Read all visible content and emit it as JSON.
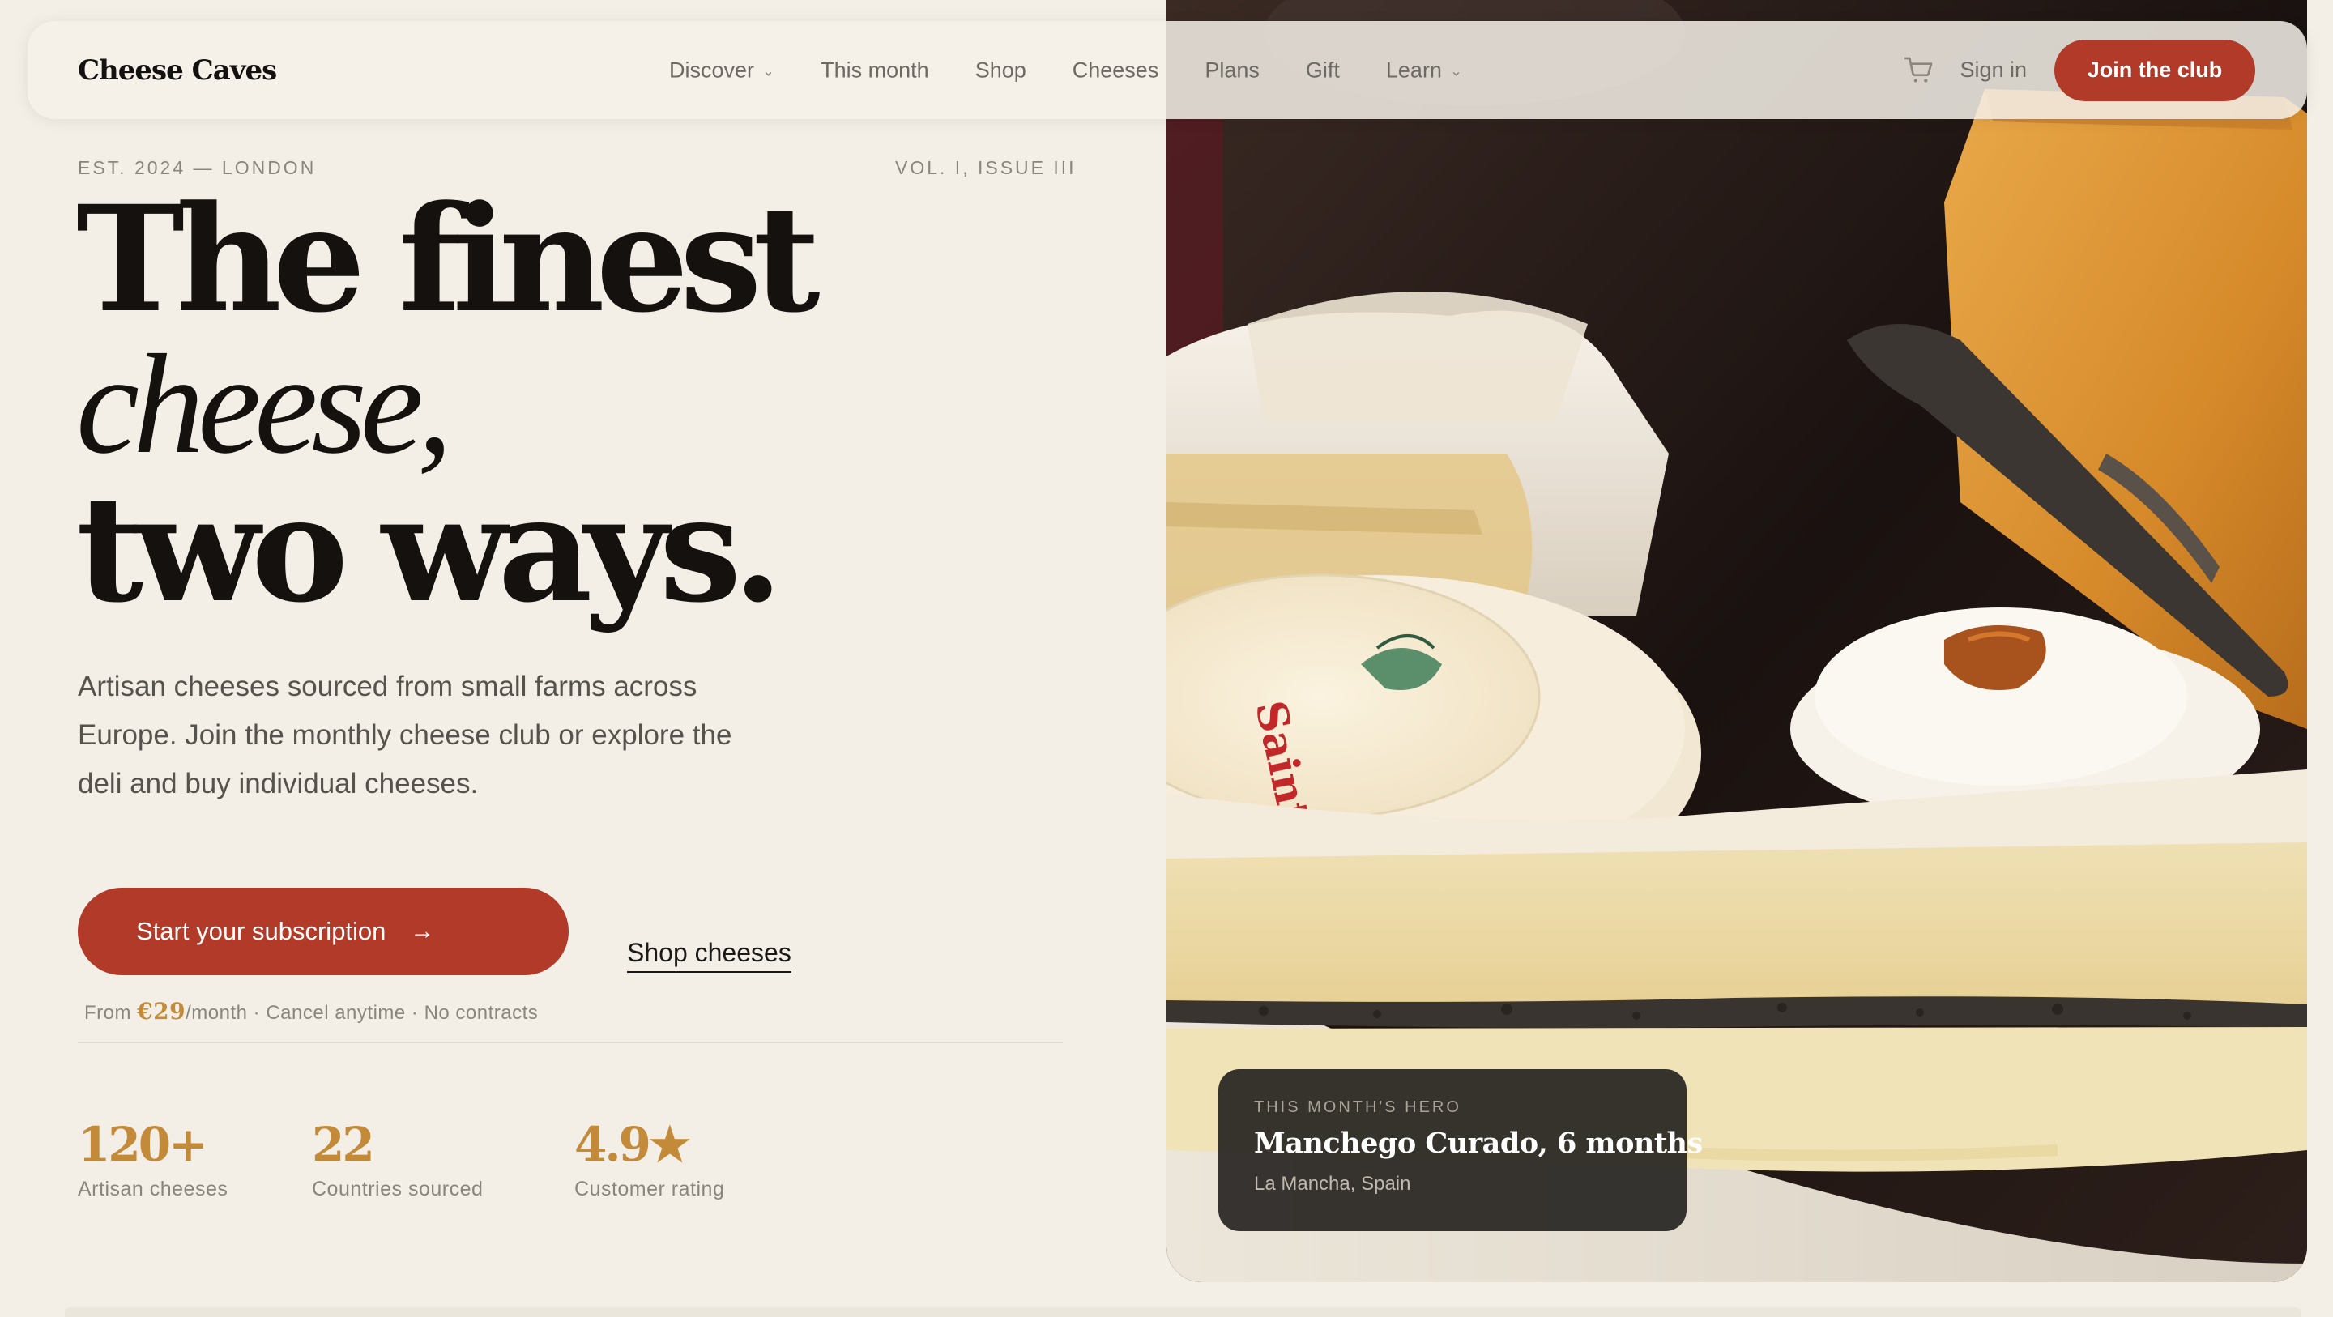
{
  "brand": "Cheese Caves",
  "nav": {
    "links": [
      {
        "label": "Discover",
        "has_menu": true
      },
      {
        "label": "This month",
        "has_menu": false
      },
      {
        "label": "Shop",
        "has_menu": false
      },
      {
        "label": "Cheeses",
        "has_menu": false
      },
      {
        "label": "Plans",
        "has_menu": false
      },
      {
        "label": "Gift",
        "has_menu": false
      },
      {
        "label": "Learn",
        "has_menu": true
      }
    ],
    "cart_icon": "cart-icon",
    "signin_label": "Sign in",
    "join_label": "Join the club"
  },
  "hero": {
    "meta_left": "EST. 2024 — LONDON",
    "meta_right": "VOL. I, ISSUE III",
    "headline_line1": "The finest",
    "headline_line2": "cheese,",
    "headline_line3": "two ways.",
    "lede": "Artisan cheeses sourced from small farms across Europe. Join the monthly cheese club or explore the deli and buy individual cheeses.",
    "cta_primary": "Start your subscription",
    "cta_primary_icon": "arrow-right-icon",
    "cta_secondary": "Shop cheeses",
    "pricing": {
      "prefix": "From ",
      "price": "€29",
      "suffix": "/month · Cancel anytime · No contracts"
    }
  },
  "stats": [
    {
      "value": "120+",
      "label": "Artisan cheeses"
    },
    {
      "value": "22",
      "label": "Countries sourced"
    },
    {
      "value": "4.9★",
      "label": "Customer rating"
    }
  ],
  "feature_card": {
    "kicker": "THIS MONTH'S HERO",
    "name": "Manchego Curado, 6 months",
    "origin": "La Mancha, Spain"
  },
  "colors": {
    "background": "#f3efe7",
    "accent": "#b23a28",
    "gold": "#c38a3a",
    "ink": "#14110e",
    "muted": "#8a857d"
  }
}
